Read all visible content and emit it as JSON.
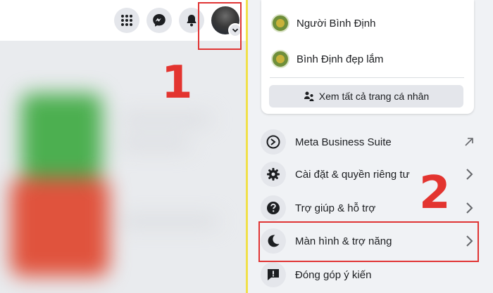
{
  "steps": {
    "one": "1",
    "two": "2"
  },
  "topbar": {
    "icons": [
      "menu-grid-icon",
      "messenger-icon",
      "bell-icon"
    ],
    "avatar_badge_icon": "chevron-down-icon"
  },
  "profiles": {
    "items": [
      {
        "label": "Người Bình Định",
        "icon": "page-avatar-icon"
      },
      {
        "label": "Bình Định đẹp lắm",
        "icon": "page-avatar-icon"
      }
    ],
    "see_all_label": "Xem tất cả trang cá nhân",
    "see_all_icon": "people-switch-icon"
  },
  "menu": {
    "items": [
      {
        "label": "Meta Business Suite",
        "icon": "business-suite-icon",
        "trail": "external-arrow-icon"
      },
      {
        "label": "Cài đặt & quyền riêng tư",
        "icon": "gear-icon",
        "trail": "chevron-right-icon"
      },
      {
        "label": "Trợ giúp & hỗ trợ",
        "icon": "help-icon",
        "trail": "chevron-right-icon"
      },
      {
        "label": "Màn hình & trợ năng",
        "icon": "moon-icon",
        "trail": "chevron-right-icon"
      },
      {
        "label": "Đóng góp ý kiến",
        "icon": "feedback-icon",
        "trail": ""
      }
    ]
  },
  "colors": {
    "annotation_red": "#e03434",
    "divider_yellow": "#f0e04a",
    "panel_bg": "#f0f2f5",
    "icon_bg": "#e4e6eb"
  }
}
